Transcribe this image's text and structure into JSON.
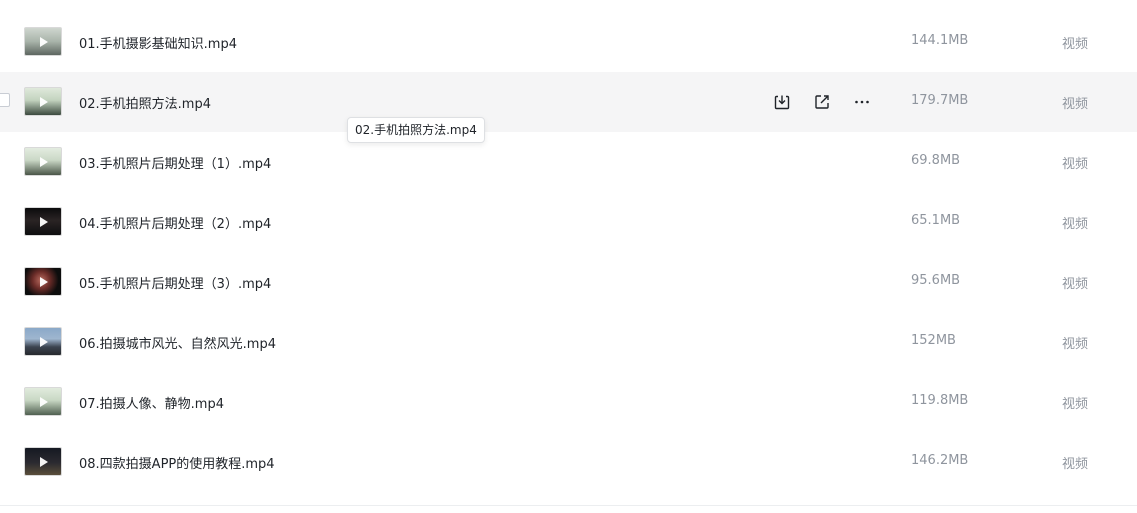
{
  "files": [
    {
      "name": "01.手机摄影基础知识.mp4",
      "size": "144.1MB",
      "type": "视频",
      "thumb": "t1"
    },
    {
      "name": "02.手机拍照方法.mp4",
      "size": "179.7MB",
      "type": "视频",
      "thumb": "t2"
    },
    {
      "name": "03.手机照片后期处理（1）.mp4",
      "size": "69.8MB",
      "type": "视频",
      "thumb": "t3"
    },
    {
      "name": "04.手机照片后期处理（2）.mp4",
      "size": "65.1MB",
      "type": "视频",
      "thumb": "t4"
    },
    {
      "name": "05.手机照片后期处理（3）.mp4",
      "size": "95.6MB",
      "type": "视频",
      "thumb": "t5"
    },
    {
      "name": "06.拍摄城市风光、自然风光.mp4",
      "size": "152MB",
      "type": "视频",
      "thumb": "t6"
    },
    {
      "name": "07.拍摄人像、静物.mp4",
      "size": "119.8MB",
      "type": "视频",
      "thumb": "t7"
    },
    {
      "name": "08.四款拍摄APP的使用教程.mp4",
      "size": "146.2MB",
      "type": "视频",
      "thumb": "t8"
    }
  ],
  "hovered_index": 1,
  "tooltip": "02.手机拍照方法.mp4",
  "row_actions": [
    "download-icon",
    "share-icon",
    "more-icon"
  ],
  "colors": {
    "hover_bg": "#f5f5f6",
    "text_primary": "#1f2329",
    "text_secondary": "#8f959e"
  }
}
